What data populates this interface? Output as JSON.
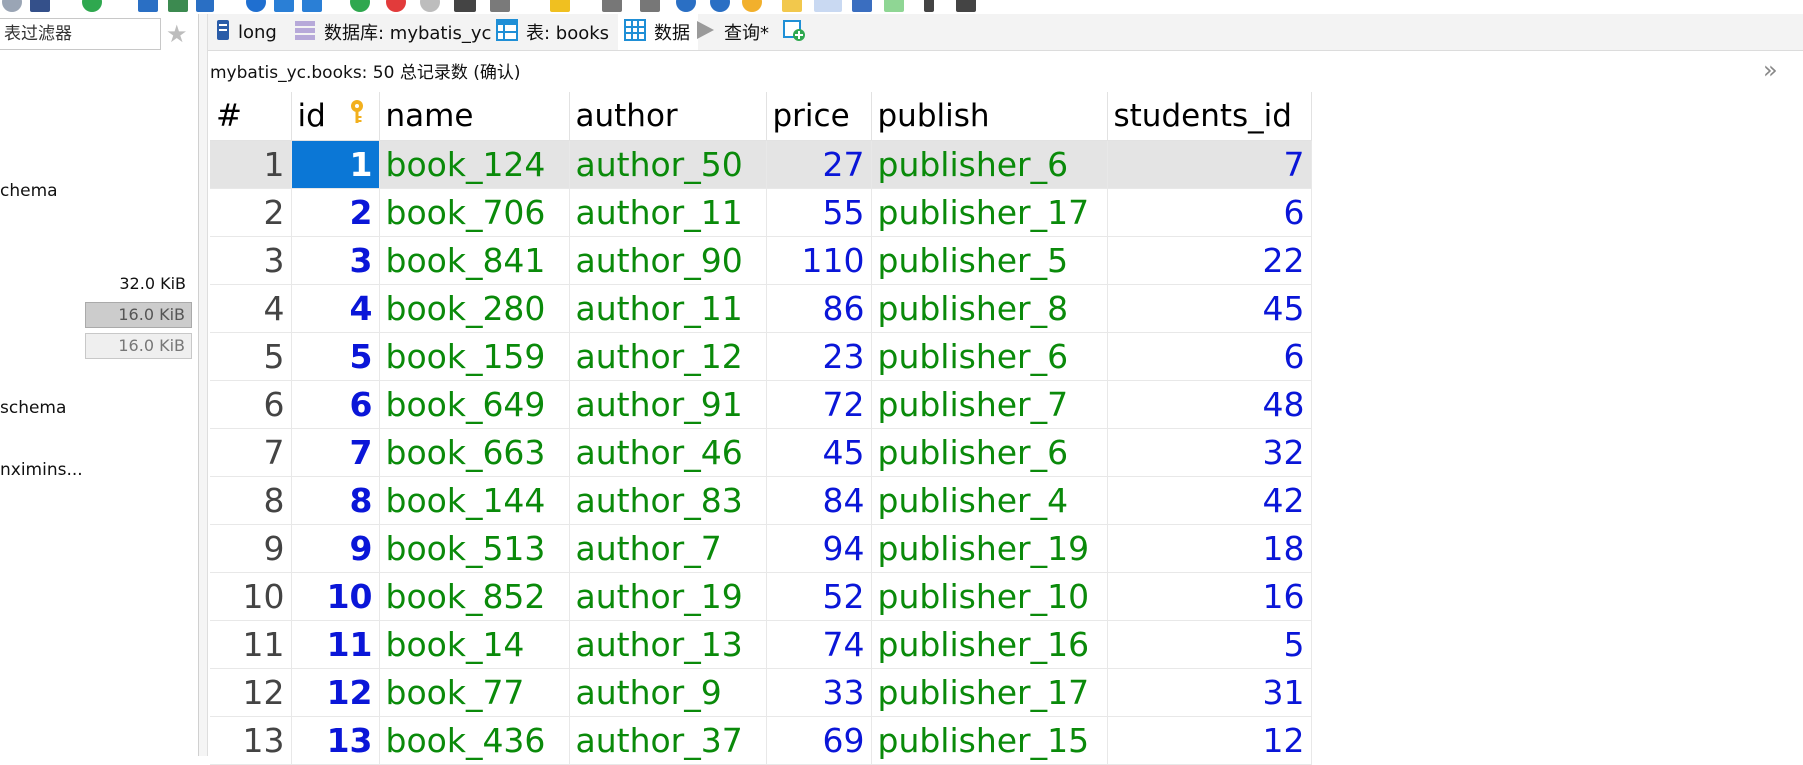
{
  "sidebar": {
    "filter_placeholder": "表过滤器",
    "items": [
      {
        "label": "chema"
      },
      {
        "label": "schema"
      },
      {
        "label": "nximins..."
      }
    ],
    "sizes": [
      "32.0 KiB",
      "16.0 KiB",
      "16.0 KiB"
    ]
  },
  "tabs": [
    {
      "label": "long",
      "icon": "server-icon"
    },
    {
      "label": "数据库: mybatis_yc",
      "icon": "database-icon"
    },
    {
      "label": "表: books",
      "icon": "table-icon"
    },
    {
      "label": "数据",
      "icon": "grid-icon"
    },
    {
      "label": "查询*",
      "icon": "play-icon"
    },
    {
      "label": "",
      "icon": "new-query-icon"
    }
  ],
  "status_text": "mybatis_yc.books: 50 总记录数 (确认)",
  "grid": {
    "columns": [
      "#",
      "id",
      "name",
      "author",
      "price",
      "publish",
      "students_id"
    ],
    "rows": [
      {
        "n": "1",
        "id": "1",
        "name": "book_124",
        "author": "author_50",
        "price": "27",
        "publish": "publisher_6",
        "students_id": "7"
      },
      {
        "n": "2",
        "id": "2",
        "name": "book_706",
        "author": "author_11",
        "price": "55",
        "publish": "publisher_17",
        "students_id": "6"
      },
      {
        "n": "3",
        "id": "3",
        "name": "book_841",
        "author": "author_90",
        "price": "110",
        "publish": "publisher_5",
        "students_id": "22"
      },
      {
        "n": "4",
        "id": "4",
        "name": "book_280",
        "author": "author_11",
        "price": "86",
        "publish": "publisher_8",
        "students_id": "45"
      },
      {
        "n": "5",
        "id": "5",
        "name": "book_159",
        "author": "author_12",
        "price": "23",
        "publish": "publisher_6",
        "students_id": "6"
      },
      {
        "n": "6",
        "id": "6",
        "name": "book_649",
        "author": "author_91",
        "price": "72",
        "publish": "publisher_7",
        "students_id": "48"
      },
      {
        "n": "7",
        "id": "7",
        "name": "book_663",
        "author": "author_46",
        "price": "45",
        "publish": "publisher_6",
        "students_id": "32"
      },
      {
        "n": "8",
        "id": "8",
        "name": "book_144",
        "author": "author_83",
        "price": "84",
        "publish": "publisher_4",
        "students_id": "42"
      },
      {
        "n": "9",
        "id": "9",
        "name": "book_513",
        "author": "author_7",
        "price": "94",
        "publish": "publisher_19",
        "students_id": "18"
      },
      {
        "n": "10",
        "id": "10",
        "name": "book_852",
        "author": "author_19",
        "price": "52",
        "publish": "publisher_10",
        "students_id": "16"
      },
      {
        "n": "11",
        "id": "11",
        "name": "book_14",
        "author": "author_13",
        "price": "74",
        "publish": "publisher_16",
        "students_id": "5"
      },
      {
        "n": "12",
        "id": "12",
        "name": "book_77",
        "author": "author_9",
        "price": "33",
        "publish": "publisher_17",
        "students_id": "31"
      },
      {
        "n": "13",
        "id": "13",
        "name": "book_436",
        "author": "author_37",
        "price": "69",
        "publish": "publisher_15",
        "students_id": "12"
      }
    ]
  },
  "colors": {
    "id_text": "#0a16d8",
    "string_text": "#0a8a0a",
    "selected_cell": "#0b77d6",
    "selected_row": "#e4e4e4"
  }
}
